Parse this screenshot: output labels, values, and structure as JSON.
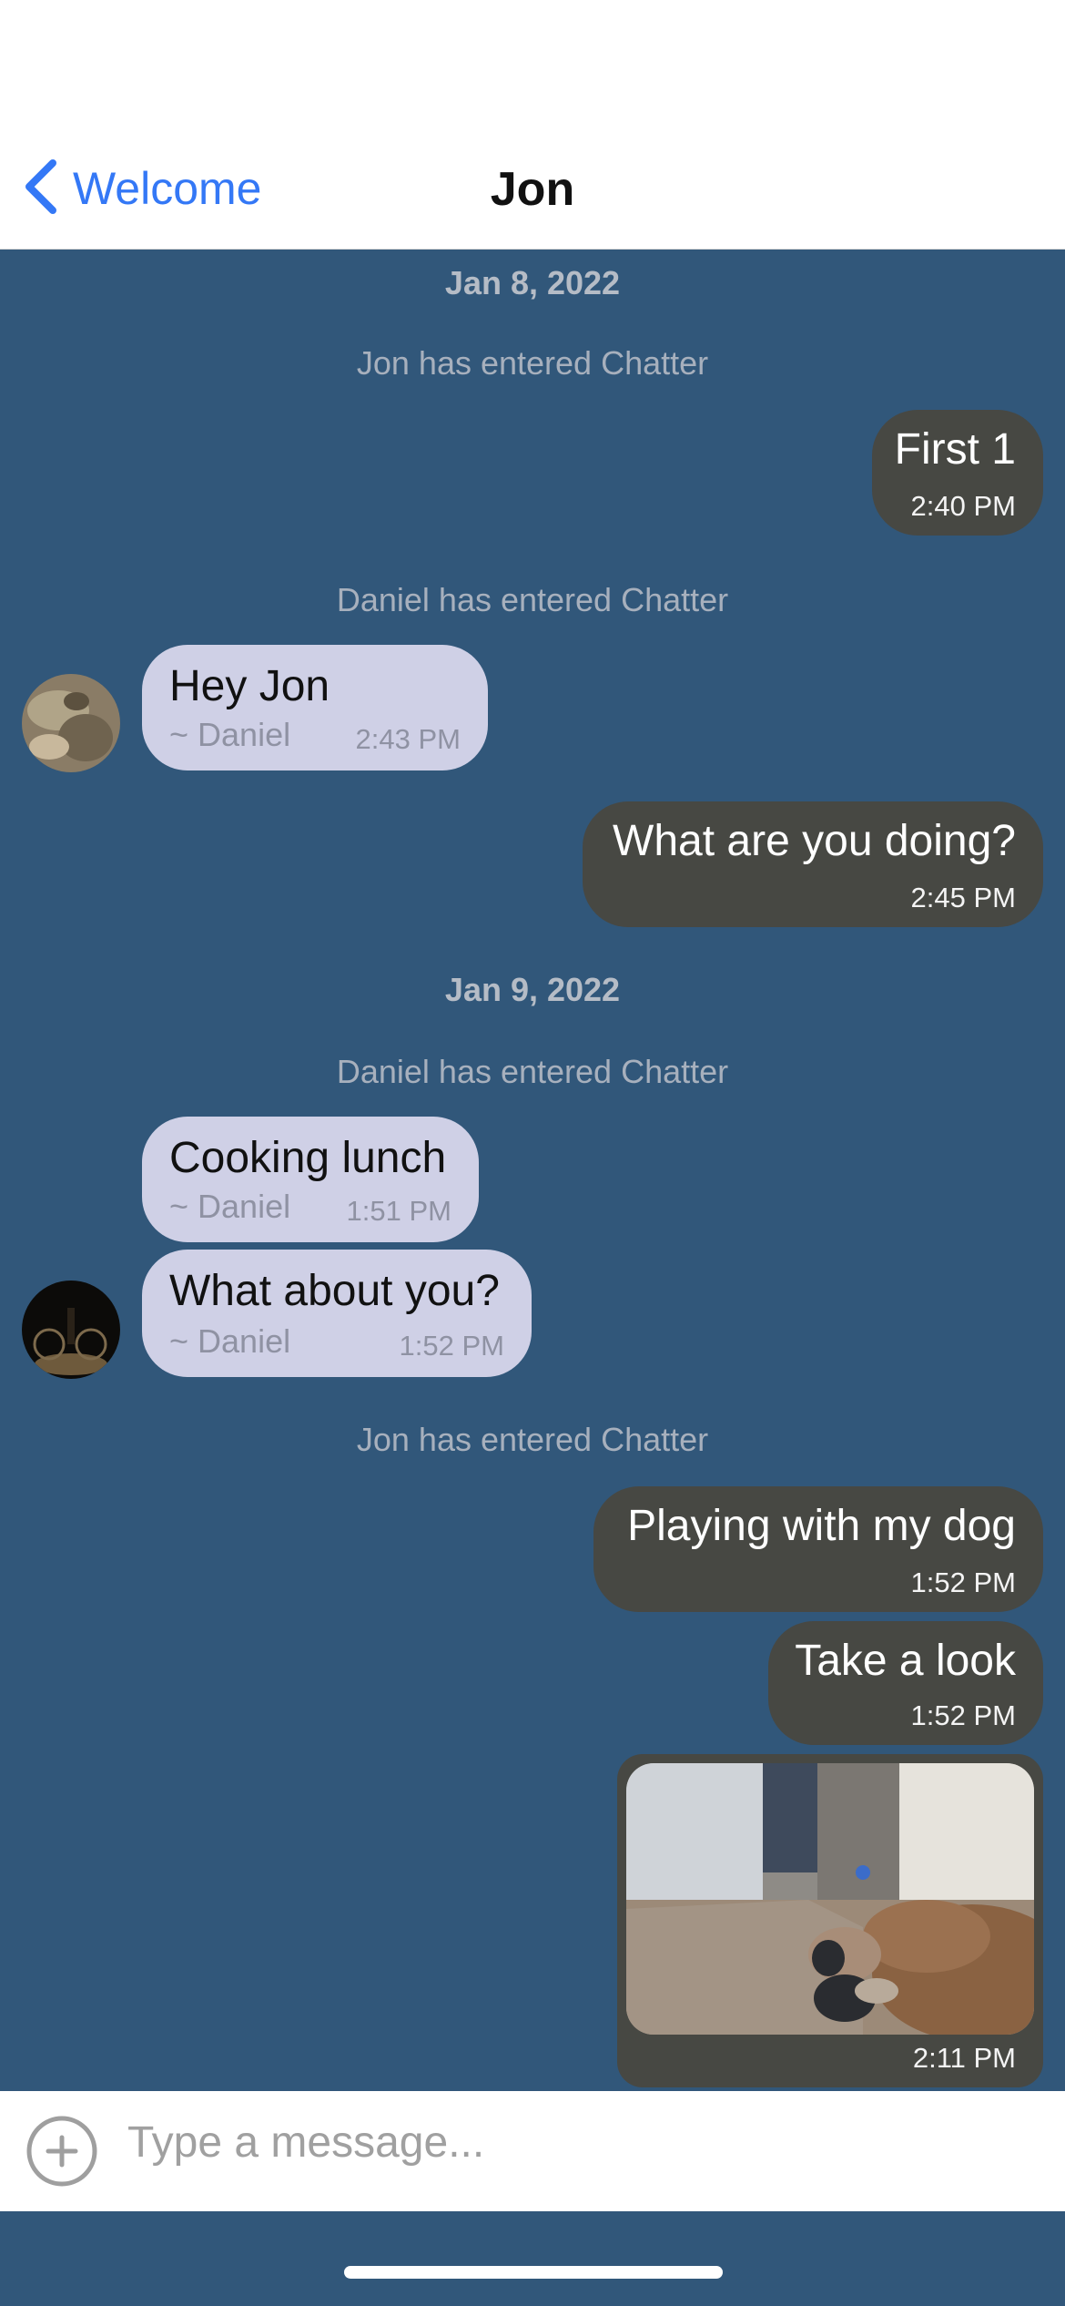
{
  "header": {
    "back_label": "Welcome",
    "title": "Jon",
    "back_icon": "chevron-left-icon",
    "accent_color": "#3478f6"
  },
  "chat": {
    "background_color": "#31577a",
    "outgoing_color": "#474843",
    "incoming_color": "#cfd0e6",
    "dates": [
      "Jan 8, 2022",
      "Jan 9, 2022"
    ],
    "system_messages": [
      "Jon has entered Chatter",
      "Daniel has entered Chatter",
      "Daniel has entered Chatter",
      "Jon has entered Chatter"
    ],
    "messages": [
      {
        "direction": "out",
        "text": "First 1",
        "time": "2:40 PM"
      },
      {
        "direction": "in",
        "text": "Hey Jon",
        "sender": "~ Daniel",
        "time": "2:43 PM"
      },
      {
        "direction": "out",
        "text": "What are you doing?",
        "time": "2:45 PM"
      },
      {
        "direction": "in",
        "text": "Cooking lunch",
        "sender": "~ Daniel",
        "time": "1:51 PM"
      },
      {
        "direction": "in",
        "text": "What about you?",
        "sender": "~ Daniel",
        "time": "1:52 PM"
      },
      {
        "direction": "out",
        "text": "Playing with my dog",
        "time": "1:52 PM"
      },
      {
        "direction": "out",
        "text": "Take a look",
        "time": "1:52 PM"
      },
      {
        "direction": "out",
        "type": "image",
        "image": "dog-on-couch-photo",
        "time": "2:11 PM"
      }
    ]
  },
  "composer": {
    "placeholder": "Type a message...",
    "value": "",
    "add_icon": "plus-circle-icon"
  }
}
